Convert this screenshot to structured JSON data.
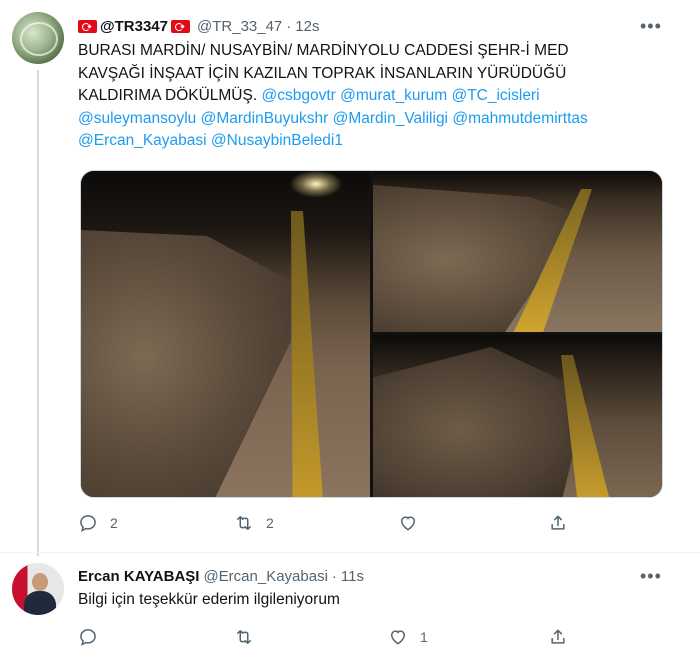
{
  "tweet1": {
    "display_name": "@TR3347",
    "handle": "@TR_33_47",
    "time": "12s",
    "text_lines": [
      {
        "plain": "BURASI MARDİN/ NUSAYBİN/ MARDİNYOLU CADDESİ ŞEHR-İ MED"
      },
      {
        "plain": "KAVŞAĞI İNŞAAT İÇİN KAZILAN TOPRAK İNSANLARIN YÜRÜDÜĞÜ"
      },
      {
        "plain": "KALDIRIMA DÖKÜLMÜŞ. ",
        "mentions": [
          "@csbgovtr",
          "@murat_kurum",
          "@TC_icisleri"
        ]
      },
      {
        "plain": "",
        "mentions": [
          "@suleymansoylu",
          "@MardinBuyukshr",
          "@Mardin_Valiligi",
          "@mahmutdemirttas"
        ]
      },
      {
        "plain": "",
        "mentions": [
          "@Ercan_Kayabasi",
          "@NusaybinBeledi1"
        ]
      }
    ],
    "reply_count": "2",
    "retweet_count": "2",
    "like_count": "",
    "more_icon": "more-horizontal-icon"
  },
  "tweet2": {
    "display_name": "Ercan KAYABAŞI",
    "handle": "@Ercan_Kayabasi",
    "time": "11s",
    "text": "Bilgi için teşekkür ederim ilgileniyorum",
    "reply_count": "",
    "retweet_count": "",
    "like_count": "1",
    "more_icon": "more-horizontal-icon"
  },
  "ui": {
    "separator": "·",
    "more_glyph": "•••"
  },
  "colors": {
    "accent": "#1d9bf0",
    "muted": "#536471",
    "text": "#0f1419",
    "flag_red": "#e30a17"
  }
}
